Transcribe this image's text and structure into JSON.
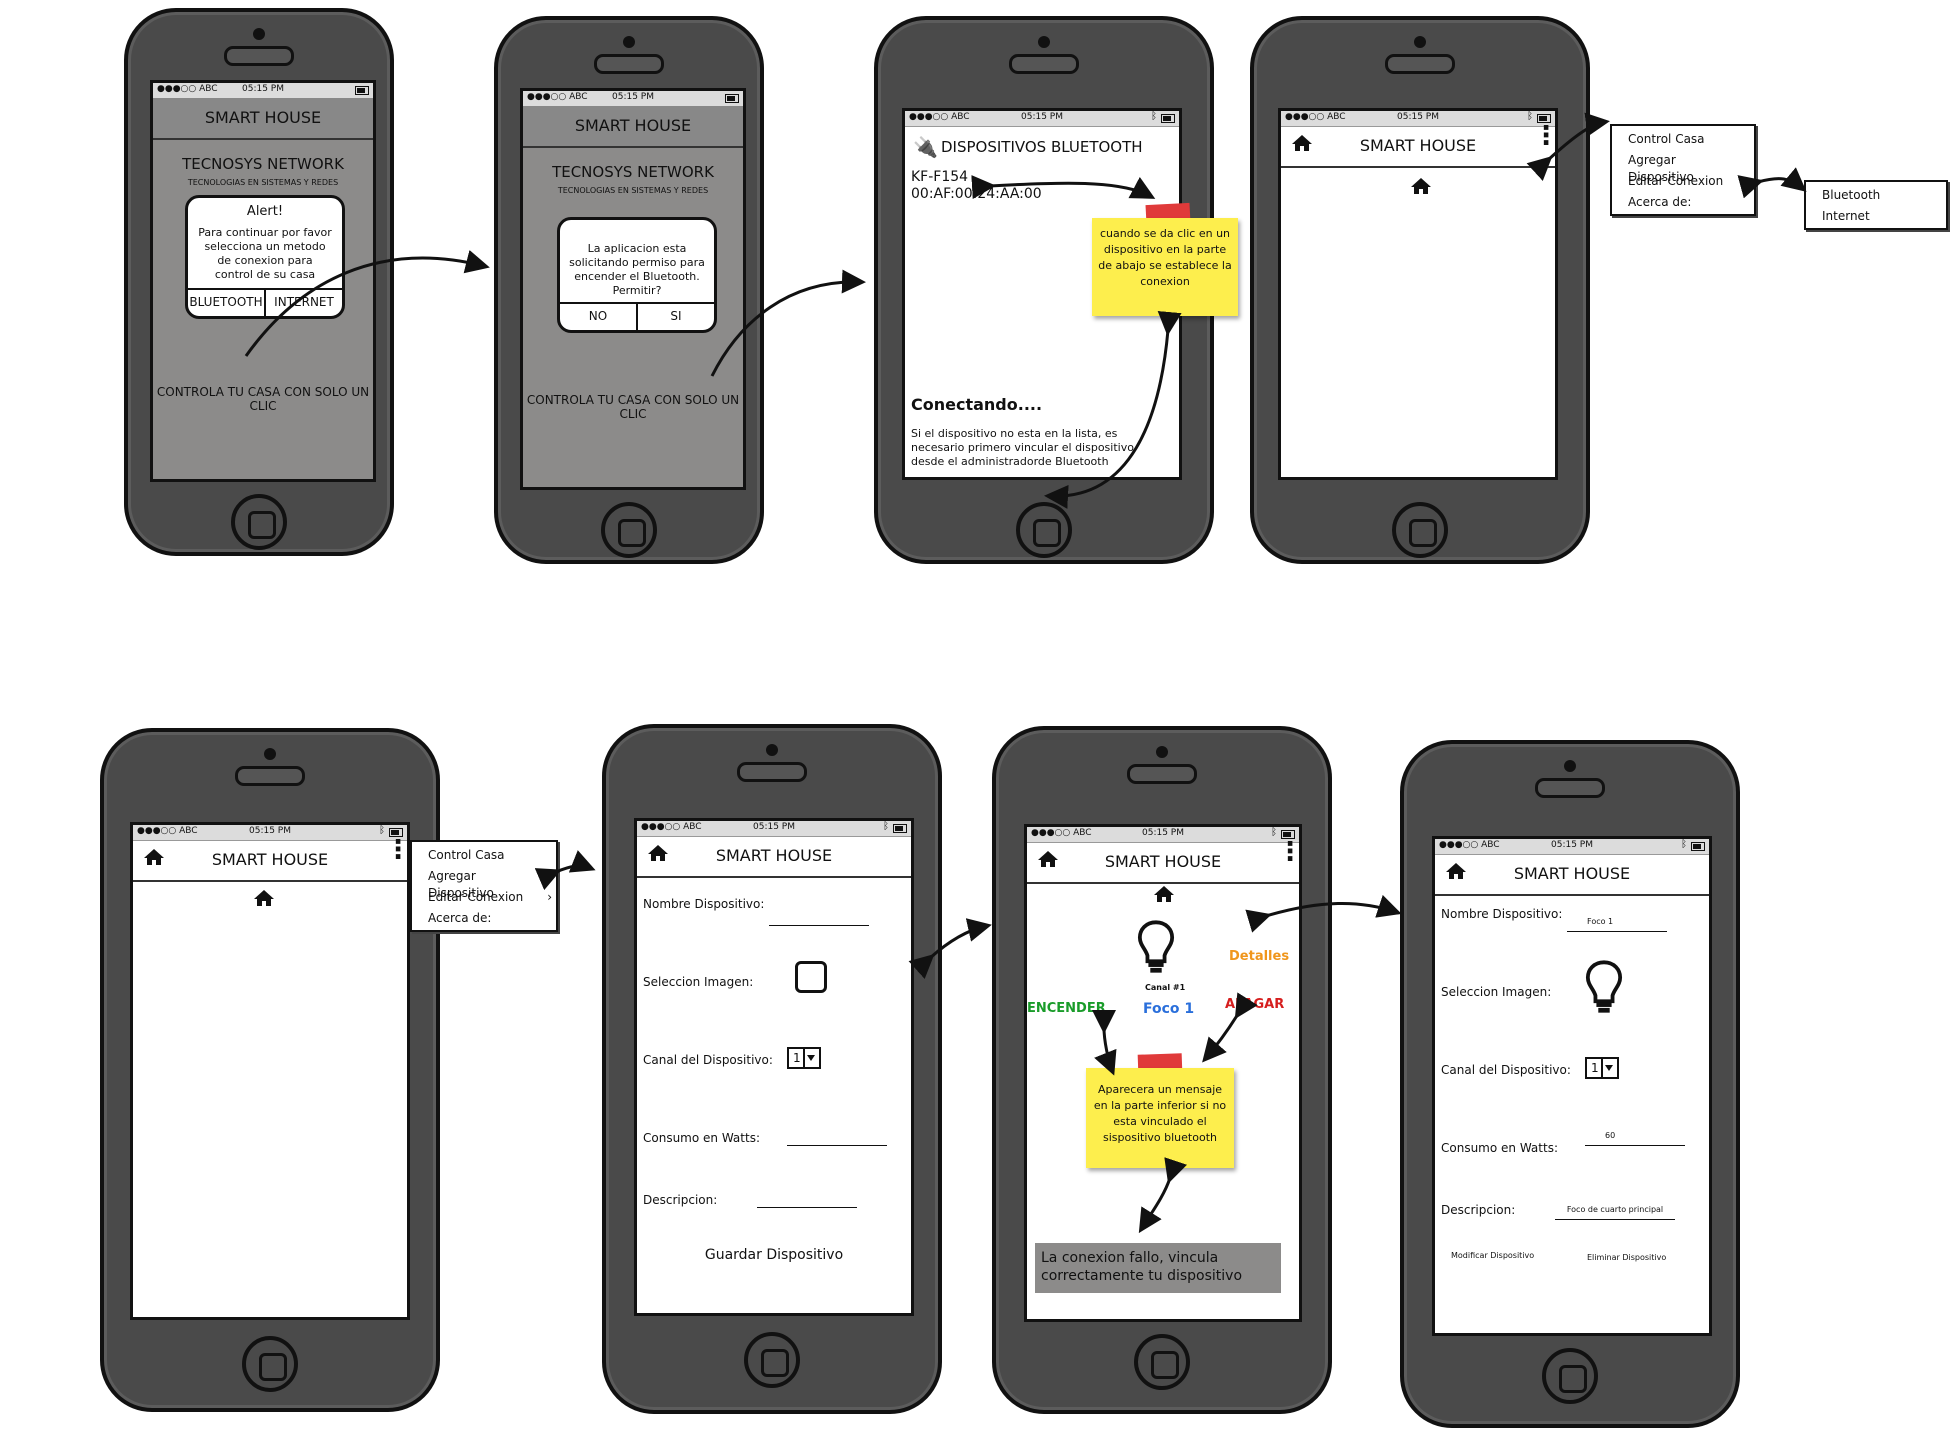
{
  "status": {
    "carrier": "●●●○○ ABC",
    "time": "05:15 PM",
    "bt": "ᛒ"
  },
  "app": {
    "title": "SMART HOUSE"
  },
  "screen1": {
    "company": "TECNOSYS NETWORK",
    "subtitle": "TECNOLOGIAS EN SISTEMAS Y REDES",
    "alert_title": "Alert!",
    "alert_text": "Para continuar por favor selecciona un metodo de conexion para control de su casa",
    "btn_bluetooth": "BLUETOOTH",
    "btn_internet": "INTERNET",
    "slogan": "CONTROLA TU CASA CON SOLO UN CLIC"
  },
  "screen2": {
    "company": "TECNOSYS NETWORK",
    "subtitle": "TECNOLOGIAS EN SISTEMAS Y REDES",
    "dialog_text": "La aplicacion esta solicitando permiso para encender el Bluetooth. Permitir?",
    "btn_no": "NO",
    "btn_si": "SI",
    "slogan": "CONTROLA TU CASA CON SOLO UN CLIC"
  },
  "screen3": {
    "title": "DISPOSITIVOS BLUETOOTH",
    "device_name": "KF-F154",
    "device_mac": "00:AF:00:24:AA:00",
    "note": "cuando se da clic en un dispositivo en la parte de abajo se establece la conexion",
    "connecting": "Conectando....",
    "help": "Si el dispositivo no esta en la lista, es necesario primero vincular el dispositivo desde el administradorde Bluetooth"
  },
  "menu_main": {
    "items": [
      "Control Casa",
      "Agregar Dispositivo",
      "Editar Conexion",
      "Acerca de:"
    ]
  },
  "submenu": {
    "items": [
      "Bluetooth",
      "Internet"
    ]
  },
  "form_add": {
    "name_label": "Nombre Dispositivo:",
    "image_label": "Seleccion Imagen:",
    "channel_label": "Canal del Dispositivo:",
    "channel_value": "1",
    "watts_label": "Consumo en Watts:",
    "desc_label": "Descripcion:",
    "save": "Guardar Dispositivo"
  },
  "control": {
    "details": "Detalles",
    "channel": "Canal #1",
    "on": "ENCENDER",
    "device": "Foco 1",
    "off": "APAGAR",
    "note": "Aparecera un mensaje en la parte inferior si no esta vinculado el sispositivo bluetooth",
    "error": "La conexion fallo, vincula correctamente tu dispositivo"
  },
  "form_edit": {
    "name_label": "Nombre Dispositivo:",
    "name_value": "Foco 1",
    "image_label": "Seleccion Imagen:",
    "channel_label": "Canal del Dispositivo:",
    "channel_value": "1",
    "watts_label": "Consumo en Watts:",
    "watts_value": "60",
    "desc_label": "Descripcion:",
    "desc_value": "Foco de cuarto principal",
    "modify": "Modificar Dispositivo",
    "delete": "Eliminar Dispositivo"
  }
}
